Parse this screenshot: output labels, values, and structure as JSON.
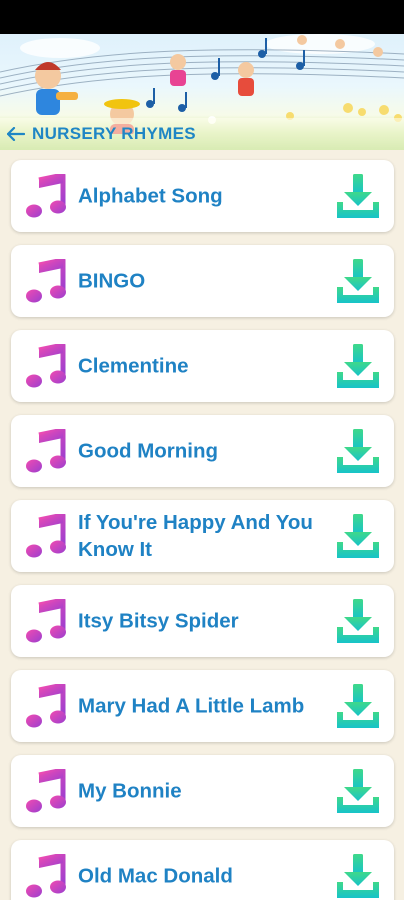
{
  "header": {
    "title": "NURSERY RHYMES"
  },
  "songs": [
    {
      "label": "Alphabet Song"
    },
    {
      "label": "BINGO"
    },
    {
      "label": "Clementine"
    },
    {
      "label": "Good Morning"
    },
    {
      "label": "If You're Happy And You Know It"
    },
    {
      "label": "Itsy Bitsy Spider"
    },
    {
      "label": "Mary Had A Little Lamb"
    },
    {
      "label": "My Bonnie"
    },
    {
      "label": "Old Mac Donald"
    }
  ],
  "icons": {
    "back": "arrow-left-icon",
    "song": "music-note-icon",
    "download": "download-icon"
  },
  "colors": {
    "accent": "#1f82c4",
    "note_gradient": [
      "#f24bb0",
      "#9b3fd0"
    ],
    "download": [
      "#3fd98a",
      "#17c3c9"
    ]
  }
}
